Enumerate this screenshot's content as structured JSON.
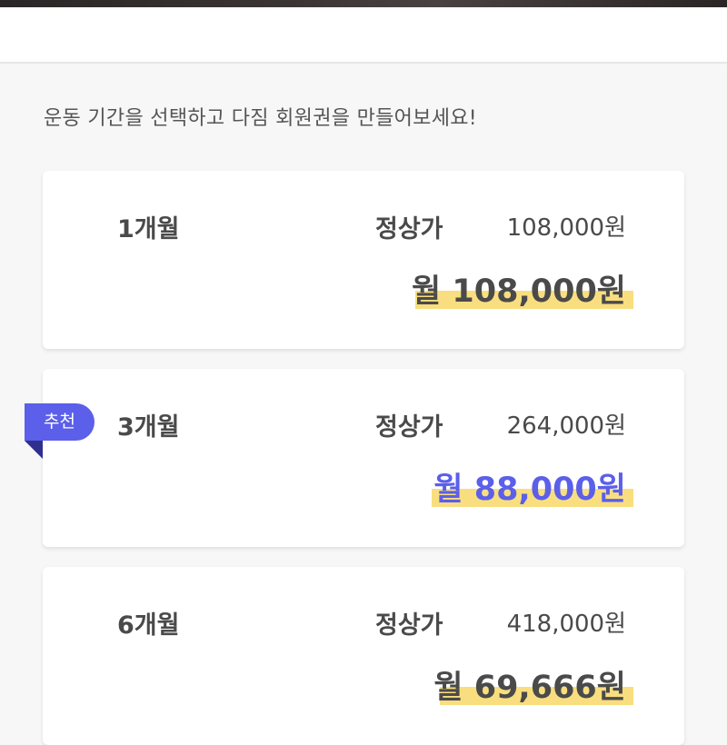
{
  "intro": "운동 기간을 선택하고 다짐 회원권을 만들어보세요!",
  "badge": "추천",
  "plans": [
    {
      "months": "1개월",
      "regular_label": "정상가",
      "regular_price": "108,000원",
      "monthly": "월 108,000원"
    },
    {
      "months": "3개월",
      "regular_label": "정상가",
      "regular_price": "264,000원",
      "monthly": "월 88,000원"
    },
    {
      "months": "6개월",
      "regular_label": "정상가",
      "regular_price": "418,000원",
      "monthly": "월 69,666원"
    }
  ],
  "colors": {
    "accent": "#5b5fe9",
    "highlight": "#f9de7f",
    "text": "#4a4a4a",
    "background": "#f7f7f7"
  }
}
